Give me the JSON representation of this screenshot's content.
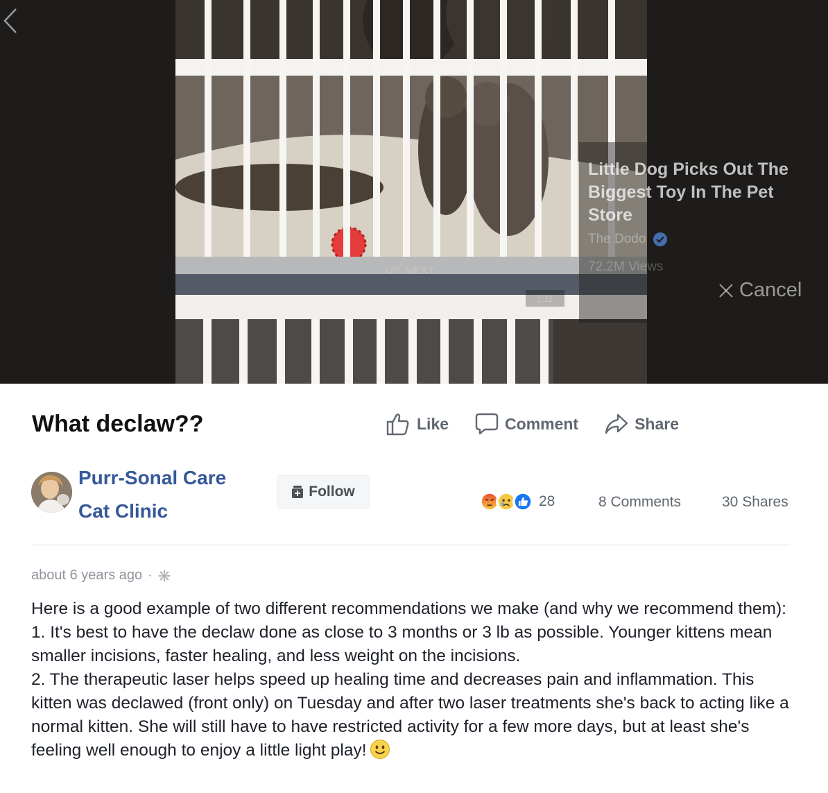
{
  "video": {
    "up_next_label": "UP NEXT",
    "up_next_duration": "1:11",
    "up_next_title": "Little Dog Picks Out The Biggest Toy In The Pet Store",
    "up_next_source": "The Dodo",
    "up_next_views": "72.2M Views",
    "cancel_label": "Cancel"
  },
  "post": {
    "title": "What declaw??",
    "actions": {
      "like": "Like",
      "comment": "Comment",
      "share": "Share"
    },
    "page_name": "Purr-Sonal Care Cat Clinic",
    "follow_label": "Follow",
    "reaction_count": "28",
    "comments_count": "8 Comments",
    "shares_count": "30 Shares",
    "time": "about 6 years ago",
    "separator": "·",
    "body": [
      "Here is a good example of two different recommendations we make (and why we recommend them):",
      "1. It's best to have the declaw done as close to 3 months or 3 lb as possible. Younger kittens mean smaller incisions, faster healing, and less weight on the incisions.",
      "2. The therapeutic laser helps speed up healing time and decreases pain and inflammation. This kitten was declawed (front only) on Tuesday and after two laser treatments she's back to acting like a normal kitten. She will still have to have restricted activity for a few more days, but at least she's feeling well enough to enjoy a little light play!"
    ]
  },
  "icons": {
    "back": "chevron-left-icon",
    "like": "thumbs-up-icon",
    "comment": "speech-bubble-icon",
    "share": "share-arrow-icon",
    "follow": "follow-icon",
    "privacy": "public-globe-icon",
    "emoji": "smile-emoji-icon"
  },
  "colors": {
    "link_blue": "#365899",
    "text_gray": "#606770",
    "meta_gray": "#90949c",
    "like_blue": "#1877f2"
  }
}
